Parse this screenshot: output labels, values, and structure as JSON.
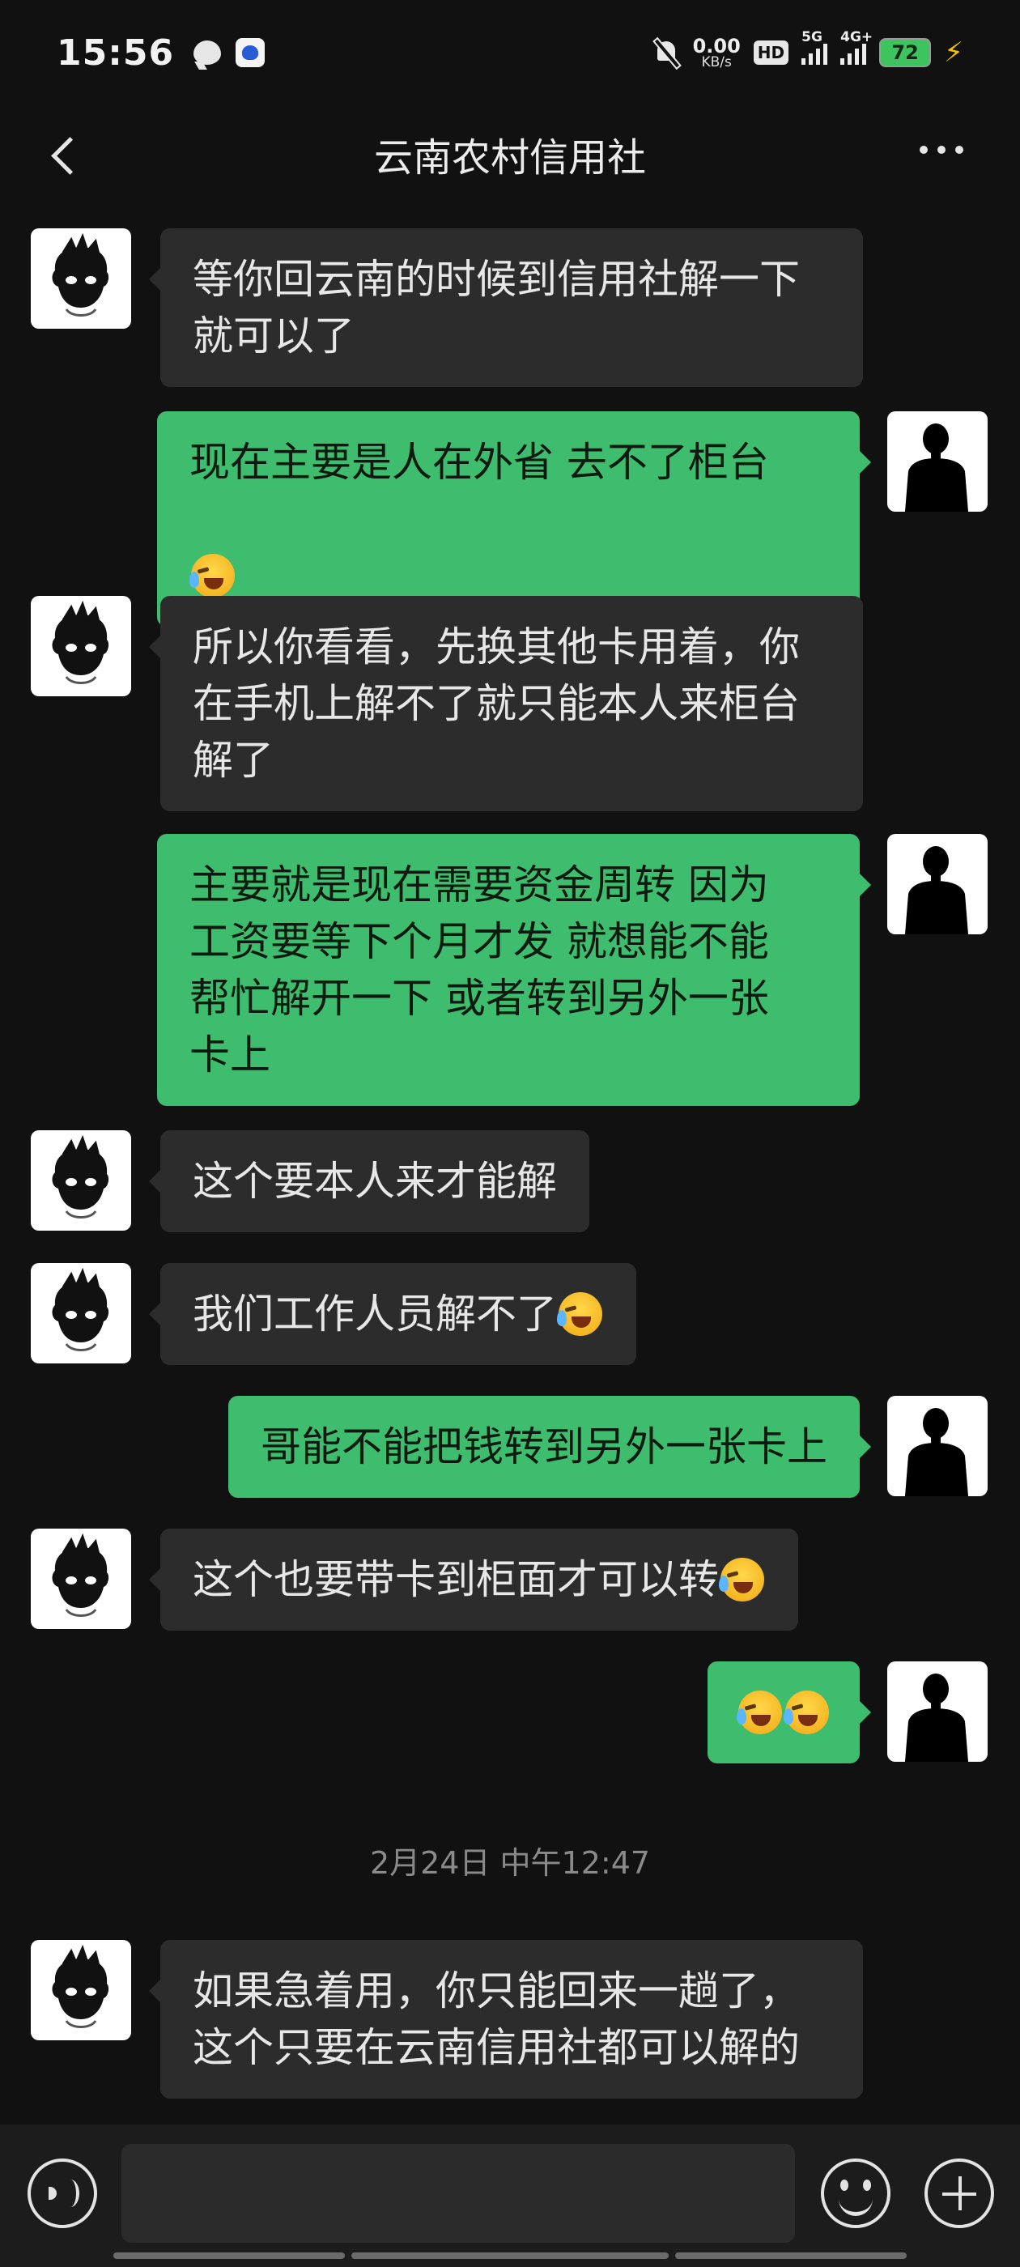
{
  "status_bar": {
    "time": "15:56",
    "net_speed_value": "0.00",
    "net_speed_unit": "KB/s",
    "hd_label": "HD",
    "signal1_label": "5G",
    "signal2_label": "4G+",
    "battery": "72",
    "colors": {
      "battery": "#3dc45e",
      "bolt": "#f2c200"
    }
  },
  "header": {
    "title": "云南农村信用社"
  },
  "messages": [
    {
      "side": "in",
      "text": "等你回云南的时候到信用社解一下\n就可以了"
    },
    {
      "side": "out",
      "text": "现在主要是人在外省 去不了柜台",
      "emoji_count": 1
    },
    {
      "side": "in",
      "text": "所以你看看，先换其他卡用着，你\n在手机上解不了就只能本人来柜台\n解了"
    },
    {
      "side": "out",
      "text": "主要就是现在需要资金周转 因为\n工资要等下个月才发 就想能不能\n帮忙解开一下 或者转到另外一张\n卡上"
    },
    {
      "side": "in",
      "text": "这个要本人来才能解"
    },
    {
      "side": "in",
      "text": "我们工作人员解不了",
      "emoji_count": 1
    },
    {
      "side": "out",
      "text": "哥能不能把钱转到另外一张卡上"
    },
    {
      "side": "in",
      "text": "这个也要带卡到柜面才可以转",
      "emoji_count": 1
    },
    {
      "side": "out",
      "text": "",
      "emoji_count": 2
    },
    {
      "side": "in",
      "text": "如果急着用，你只能回来一趟了，\n这个只要在云南信用社都可以解的"
    }
  ],
  "timestamp": "2月24日 中午12:47",
  "input_bar": {
    "text_value": "",
    "placeholder": ""
  },
  "icons": {
    "back": "back-arrow-icon",
    "more": "more-dots-icon",
    "voice": "voice-icon",
    "emoji": "emoji-face-icon",
    "plus": "plus-icon",
    "reaction": "laughing-tears-emoji"
  },
  "colors": {
    "background": "#111111",
    "incoming_bubble": "#2c2c2c",
    "outgoing_bubble": "#3ebd6e",
    "input_bar": "#1c1c1c"
  }
}
